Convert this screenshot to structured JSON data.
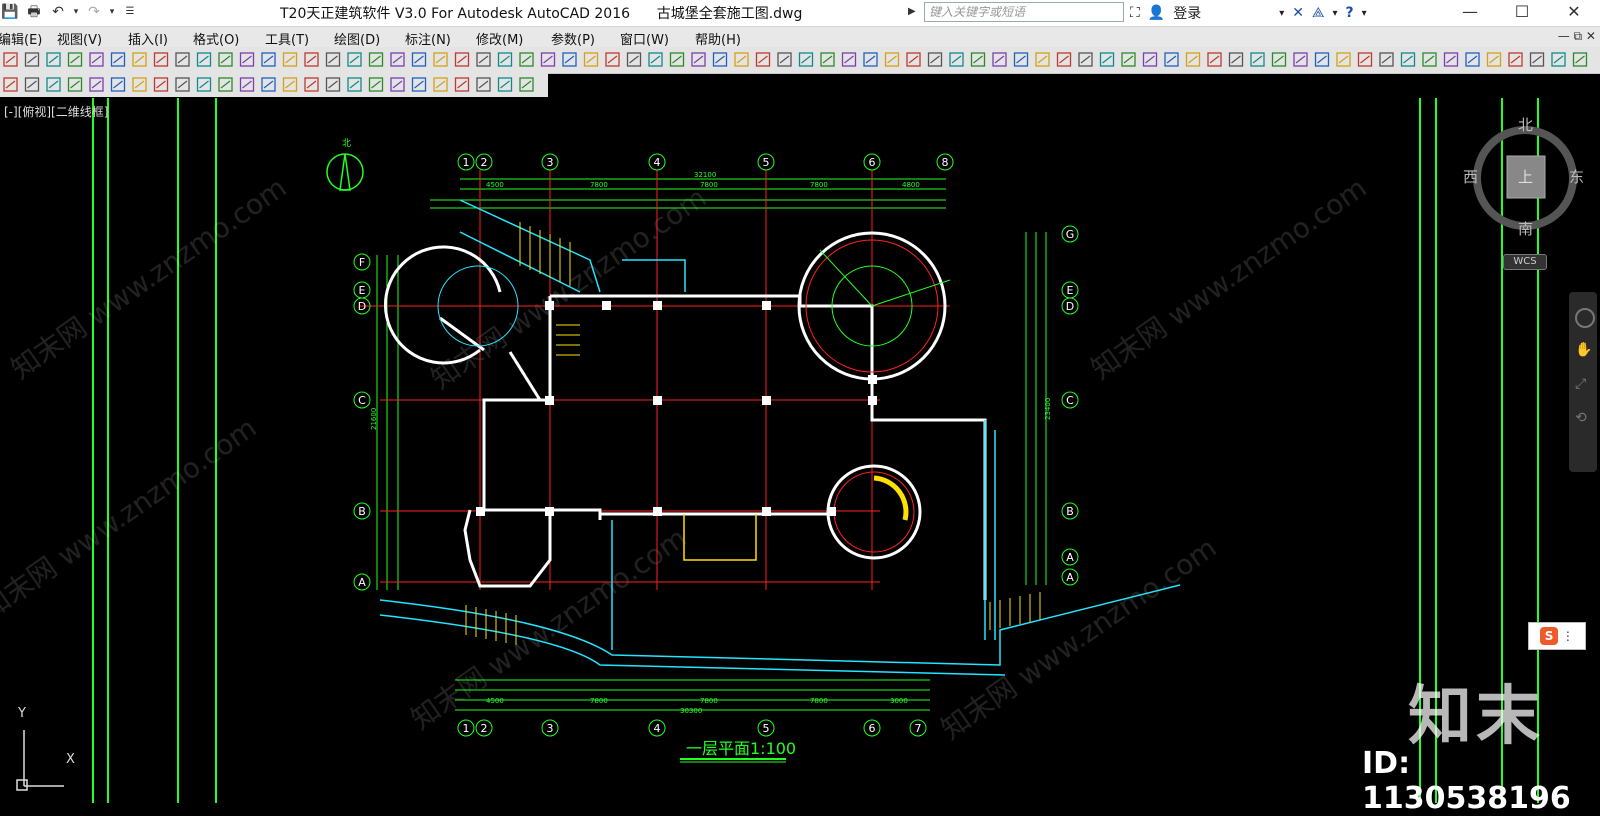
{
  "window": {
    "title": "T20天正建筑软件 V3.0 For Autodesk AutoCAD 2016",
    "document": "古城堡全套施工图.dwg",
    "search_placeholder": "键入关键字或短语",
    "login_label": "登录"
  },
  "menu": [
    {
      "label": "编辑(E)"
    },
    {
      "label": "视图(V)"
    },
    {
      "label": "插入(I)"
    },
    {
      "label": "格式(O)"
    },
    {
      "label": "工具(T)"
    },
    {
      "label": "绘图(D)"
    },
    {
      "label": "标注(N)"
    },
    {
      "label": "修改(M)"
    },
    {
      "label": "参数(P)"
    },
    {
      "label": "窗口(W)"
    },
    {
      "label": "帮助(H)"
    }
  ],
  "viewport": {
    "label": "[-][俯视][二维线框]"
  },
  "viewcube": {
    "north": "北",
    "south": "南",
    "east": "东",
    "west": "西",
    "face": "上",
    "wcs": "WCS"
  },
  "ucs": {
    "x": "X",
    "y": "Y"
  },
  "drawing": {
    "title": "一层平面1:100",
    "north_label": "北",
    "top_axes": [
      "1",
      "2",
      "3",
      "4",
      "5",
      "6",
      "8"
    ],
    "bottom_axes": [
      "1",
      "2",
      "3",
      "4",
      "5",
      "6",
      "7"
    ],
    "left_axes": [
      "F",
      "E",
      "D",
      "C",
      "B",
      "A"
    ],
    "right_axes": [
      "G",
      "E",
      "D",
      "C",
      "B",
      "A",
      "A"
    ],
    "top_total": "32100",
    "bottom_total": "30300",
    "left_total": "21600",
    "right_total": "23400",
    "top_spans": [
      "4500",
      "7800",
      "7800",
      "7800",
      "4800"
    ],
    "bottom_spans": [
      "4500",
      "7800",
      "7800",
      "7800",
      "3000"
    ]
  },
  "watermark": {
    "logo": "知末",
    "id": "ID: 1130538196",
    "repeat": "知末网 www.znzmo.com"
  },
  "colors": {
    "wall": "#ffffff",
    "axis": "#ff2020",
    "dim": "#22ff22",
    "cyan": "#22e5ff",
    "yellow": "#ffe000"
  }
}
